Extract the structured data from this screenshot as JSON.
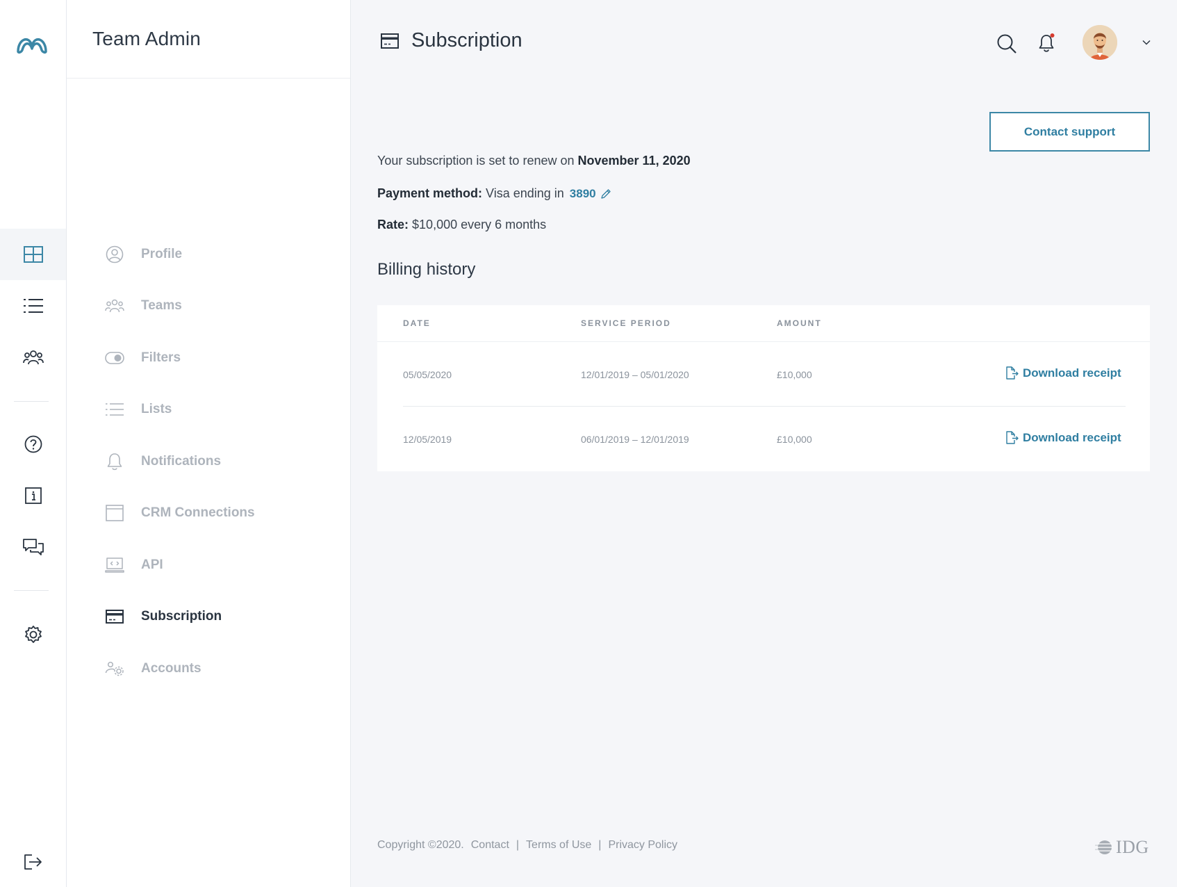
{
  "rail": {
    "logo": "brand-logo",
    "items": [
      {
        "icon": "grid-icon",
        "active": true
      },
      {
        "icon": "list-icon"
      },
      {
        "icon": "people-icon"
      },
      {
        "icon": "help-icon"
      },
      {
        "icon": "info-icon"
      },
      {
        "icon": "chat-icon"
      },
      {
        "icon": "gear-icon"
      },
      {
        "icon": "logout-icon"
      }
    ]
  },
  "sidebar": {
    "title": "Team Admin",
    "items": [
      {
        "label": "Profile",
        "icon": "profile-icon"
      },
      {
        "label": "Teams",
        "icon": "teams-icon"
      },
      {
        "label": "Filters",
        "icon": "toggle-icon"
      },
      {
        "label": "Lists",
        "icon": "list-icon"
      },
      {
        "label": "Notifications",
        "icon": "bell-icon"
      },
      {
        "label": "CRM Connections",
        "icon": "window-icon"
      },
      {
        "label": "API",
        "icon": "laptop-code-icon"
      },
      {
        "label": "Subscription",
        "icon": "credit-card-icon",
        "active": true
      },
      {
        "label": "Accounts",
        "icon": "accounts-gear-icon"
      }
    ]
  },
  "header": {
    "title": "Subscription",
    "icons": [
      "search-icon",
      "bell-icon",
      "avatar",
      "chevron-down-icon"
    ]
  },
  "subscription": {
    "contact_button": "Contact support",
    "renew_text": "Your subscription is set to renew on",
    "renew_date": "November 11, 2020",
    "payment_label": "Payment method:",
    "payment_text": "Visa ending in",
    "card_last4": "3890",
    "rate_label": "Rate:",
    "rate_value": "$10,000 every 6 months"
  },
  "billing": {
    "title": "Billing history",
    "columns": [
      "DATE",
      "SERVICE PERIOD",
      "AMOUNT"
    ],
    "rows": [
      {
        "date": "05/05/2020",
        "period": "12/01/2019 – 05/01/2020",
        "amount": "£10,000",
        "action": "Download receipt"
      },
      {
        "date": "12/05/2019",
        "period": "06/01/2019 – 12/01/2019",
        "amount": "£10,000",
        "action": "Download receipt"
      }
    ]
  },
  "footer": {
    "copyright": "Copyright ©2020.",
    "links": [
      "Contact",
      "Terms of Use",
      "Privacy Policy"
    ],
    "separator": "|",
    "brand": "IDG"
  },
  "colors": {
    "accent": "#2f7ea1",
    "background": "#f5f6f9",
    "muted": "#aeb4bc",
    "notification_dot": "#d63b2f"
  }
}
